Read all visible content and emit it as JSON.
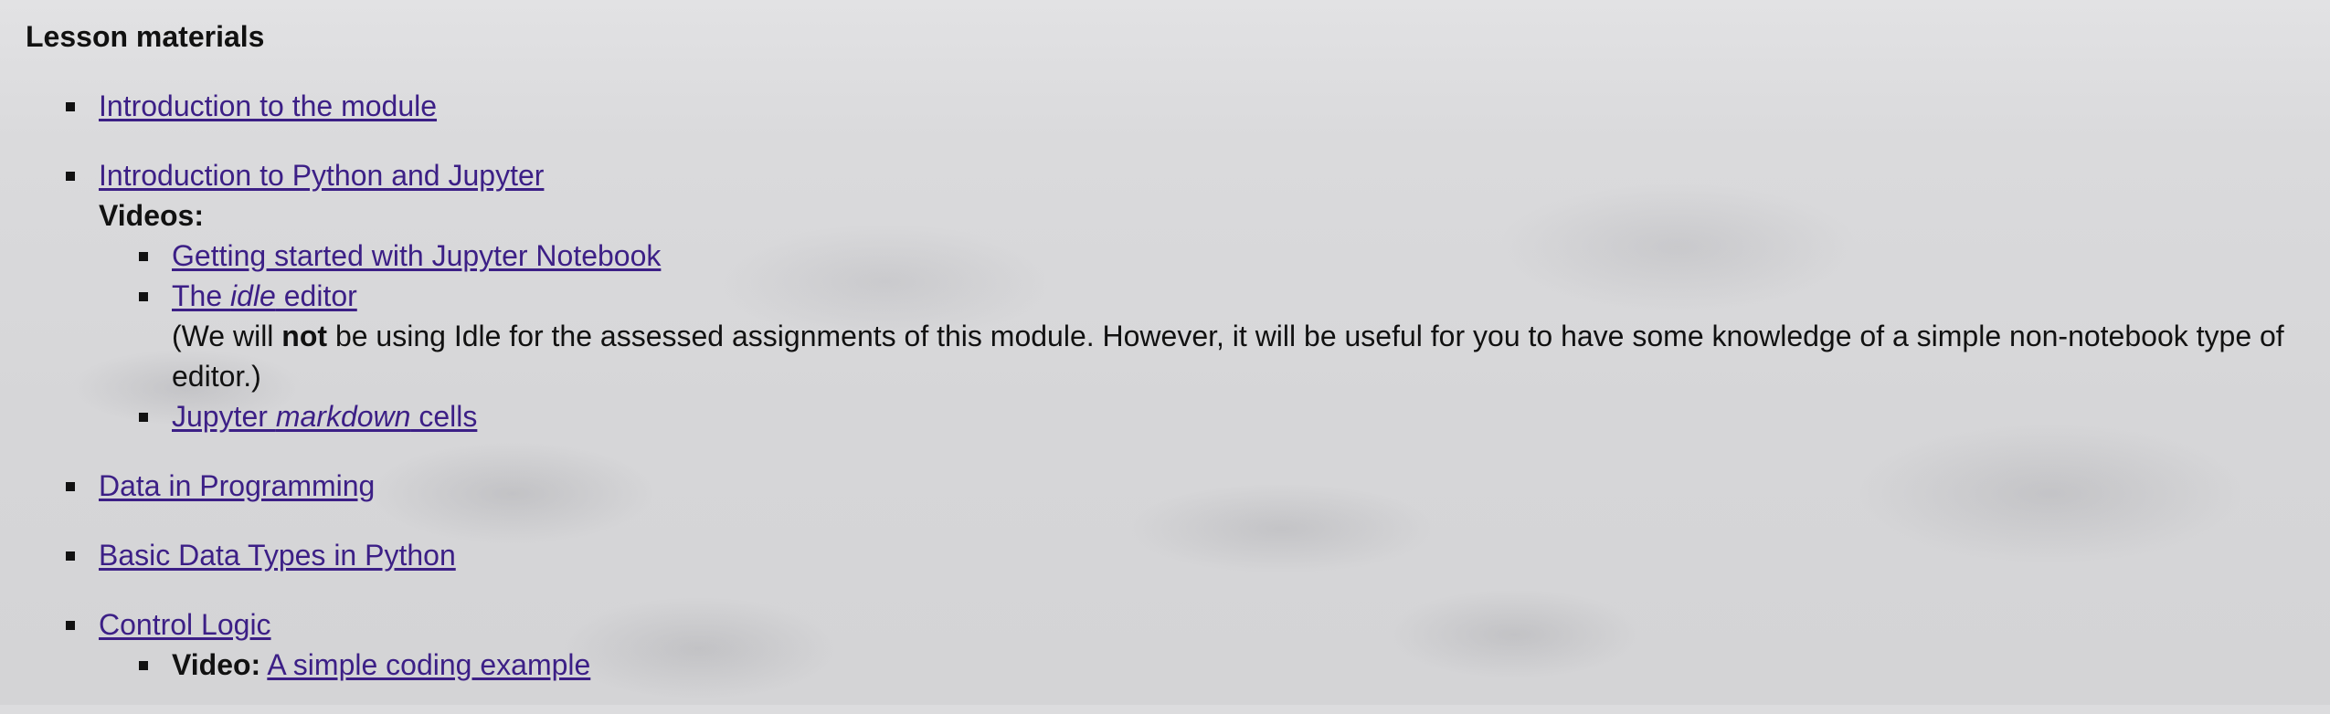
{
  "heading": "Lesson materials",
  "items": {
    "intro_module": "Introduction to the module",
    "intro_python": "Introduction to Python and Jupyter",
    "videos_label": "Videos:",
    "video_jupyter": "Getting started with Jupyter Notebook",
    "video_idle_pre": "The ",
    "video_idle_em": "idle",
    "video_idle_post": " editor",
    "note_open": "(We will ",
    "note_bold": "not",
    "note_rest": " be using Idle for the assessed assignments of this module. However, it will be useful for you to have some knowledge of a simple non-notebook type of editor.)",
    "video_markdown_pre": "Jupyter ",
    "video_markdown_em": "markdown",
    "video_markdown_post": " cells",
    "data_programming": "Data in Programming",
    "basic_types": "Basic Data Types in Python",
    "control_logic": "Control Logic",
    "video_label": "Video:",
    "video_coding": "A simple coding example"
  },
  "colors": {
    "link": "#3c1f86",
    "text": "#111111"
  }
}
